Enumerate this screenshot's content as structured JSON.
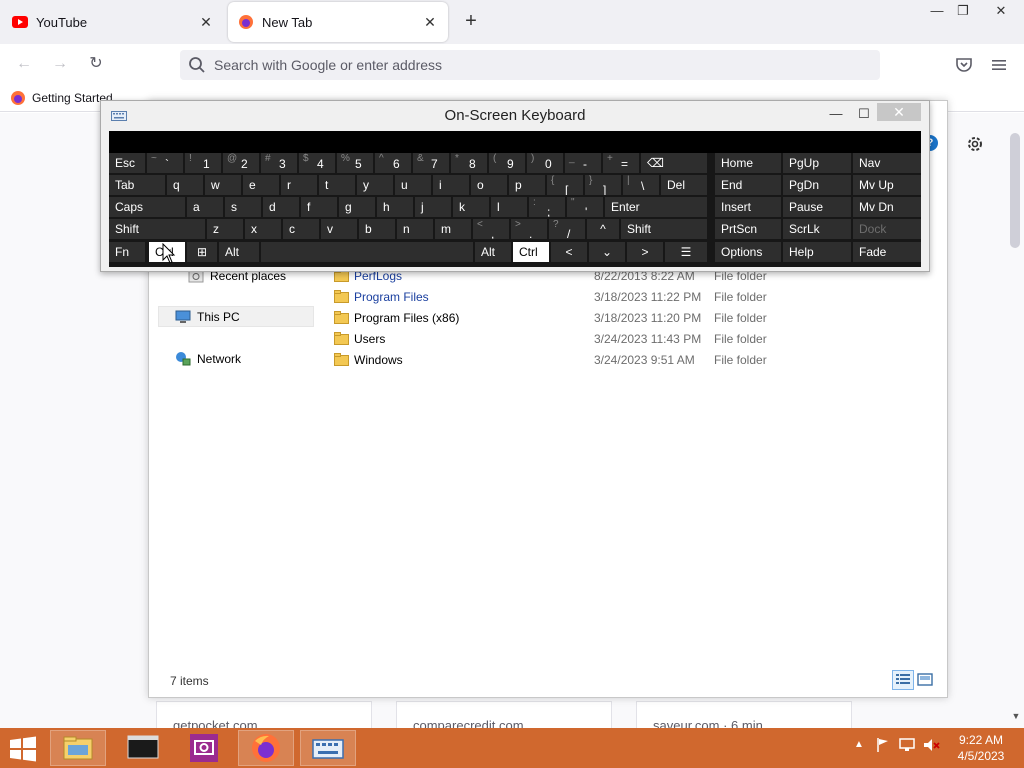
{
  "browser": {
    "tabs": [
      {
        "title": "YouTube",
        "active": false
      },
      {
        "title": "New Tab",
        "active": true
      }
    ],
    "new_tab_symbol": "+",
    "window_controls": {
      "minimize": "—",
      "restore": "❐",
      "close": "✕"
    },
    "url_placeholder": "Search with Google or enter address",
    "bookmarks": [
      {
        "label": "Getting Started"
      }
    ],
    "colors": {
      "tabstrip": "#f0f0f4",
      "urlbar": "#f0f0f4"
    }
  },
  "page": {
    "cards": [
      "getpocket.com",
      "comparecredit.com",
      "saveur.com · 6 min"
    ]
  },
  "explorer": {
    "nav_pane": [
      {
        "label": "Recent places"
      },
      {
        "label": "This PC",
        "selected": true
      },
      {
        "label": "Network"
      }
    ],
    "files": [
      {
        "name": "PerfLogs",
        "date": "8/22/2013 8:22 AM",
        "type": "File folder",
        "link": true
      },
      {
        "name": "Program Files",
        "date": "3/18/2023 11:22 PM",
        "type": "File folder",
        "link": true
      },
      {
        "name": "Program Files (x86)",
        "date": "3/18/2023 11:20 PM",
        "type": "File folder",
        "link": false
      },
      {
        "name": "Users",
        "date": "3/24/2023 11:43 PM",
        "type": "File folder",
        "link": false
      },
      {
        "name": "Windows",
        "date": "3/24/2023 9:51 AM",
        "type": "File folder",
        "link": false
      }
    ],
    "status": "7 items"
  },
  "osk": {
    "title": "On-Screen Keyboard",
    "controls": {
      "minimize": "—",
      "maximize": "☐",
      "close": "✕"
    },
    "rows": [
      [
        {
          "label": "Esc"
        },
        {
          "alt": "~",
          "label": "`"
        },
        {
          "alt": "!",
          "label": "1"
        },
        {
          "alt": "@",
          "label": "2"
        },
        {
          "alt": "#",
          "label": "3"
        },
        {
          "alt": "$",
          "label": "4"
        },
        {
          "alt": "%",
          "label": "5"
        },
        {
          "alt": "^",
          "label": "6"
        },
        {
          "alt": "&",
          "label": "7"
        },
        {
          "alt": "*",
          "label": "8"
        },
        {
          "alt": "(",
          "label": "9"
        },
        {
          "alt": ")",
          "label": "0"
        },
        {
          "alt": "_",
          "label": "-"
        },
        {
          "alt": "+",
          "label": "="
        },
        {
          "label": "⌫"
        }
      ],
      [
        {
          "label": "Tab"
        },
        {
          "label": "q"
        },
        {
          "label": "w"
        },
        {
          "label": "e"
        },
        {
          "label": "r"
        },
        {
          "label": "t"
        },
        {
          "label": "y"
        },
        {
          "label": "u"
        },
        {
          "label": "i"
        },
        {
          "label": "o"
        },
        {
          "label": "p"
        },
        {
          "alt": "{",
          "label": "["
        },
        {
          "alt": "}",
          "label": "]"
        },
        {
          "alt": "|",
          "label": "\\"
        },
        {
          "label": "Del"
        }
      ],
      [
        {
          "label": "Caps"
        },
        {
          "label": "a"
        },
        {
          "label": "s"
        },
        {
          "label": "d"
        },
        {
          "label": "f"
        },
        {
          "label": "g"
        },
        {
          "label": "h"
        },
        {
          "label": "j"
        },
        {
          "label": "k"
        },
        {
          "label": "l"
        },
        {
          "alt": ":",
          "label": ";"
        },
        {
          "alt": "\"",
          "label": "'"
        },
        {
          "label": "Enter"
        }
      ],
      [
        {
          "label": "Shift"
        },
        {
          "label": "z"
        },
        {
          "label": "x"
        },
        {
          "label": "c"
        },
        {
          "label": "v"
        },
        {
          "label": "b"
        },
        {
          "label": "n"
        },
        {
          "label": "m"
        },
        {
          "alt": "<",
          "label": ","
        },
        {
          "alt": ">",
          "label": "."
        },
        {
          "alt": "?",
          "label": "/"
        },
        {
          "label": "^"
        },
        {
          "label": "Shift"
        }
      ],
      [
        {
          "label": "Fn"
        },
        {
          "label": "Ctrl",
          "pressed": true
        },
        {
          "label": "⊞"
        },
        {
          "label": "Alt"
        },
        {
          "label": ""
        },
        {
          "label": "Alt"
        },
        {
          "label": "Ctrl",
          "pressed": true
        },
        {
          "label": "<"
        },
        {
          "label": "⌄"
        },
        {
          "label": ">"
        },
        {
          "label": "☰"
        }
      ]
    ],
    "nav_keys": [
      [
        "Home",
        "PgUp",
        "Nav"
      ],
      [
        "End",
        "PgDn",
        "Mv Up"
      ],
      [
        "Insert",
        "Pause",
        "Mv Dn"
      ],
      [
        "PrtScn",
        "ScrLk",
        "Dock"
      ],
      [
        "Options",
        "Help",
        "Fade"
      ]
    ],
    "disabled_keys": [
      "Dock"
    ],
    "colors": {
      "key": "#2e2e2e",
      "board": "#171717",
      "pressed": "#ffffff"
    }
  },
  "taskbar": {
    "apps": [
      "file-explorer",
      "command-prompt",
      "screenshot-tool",
      "firefox",
      "on-screen-keyboard"
    ],
    "clock": {
      "time": "9:22 AM",
      "date": "4/5/2023"
    },
    "color": "#d0682e"
  }
}
